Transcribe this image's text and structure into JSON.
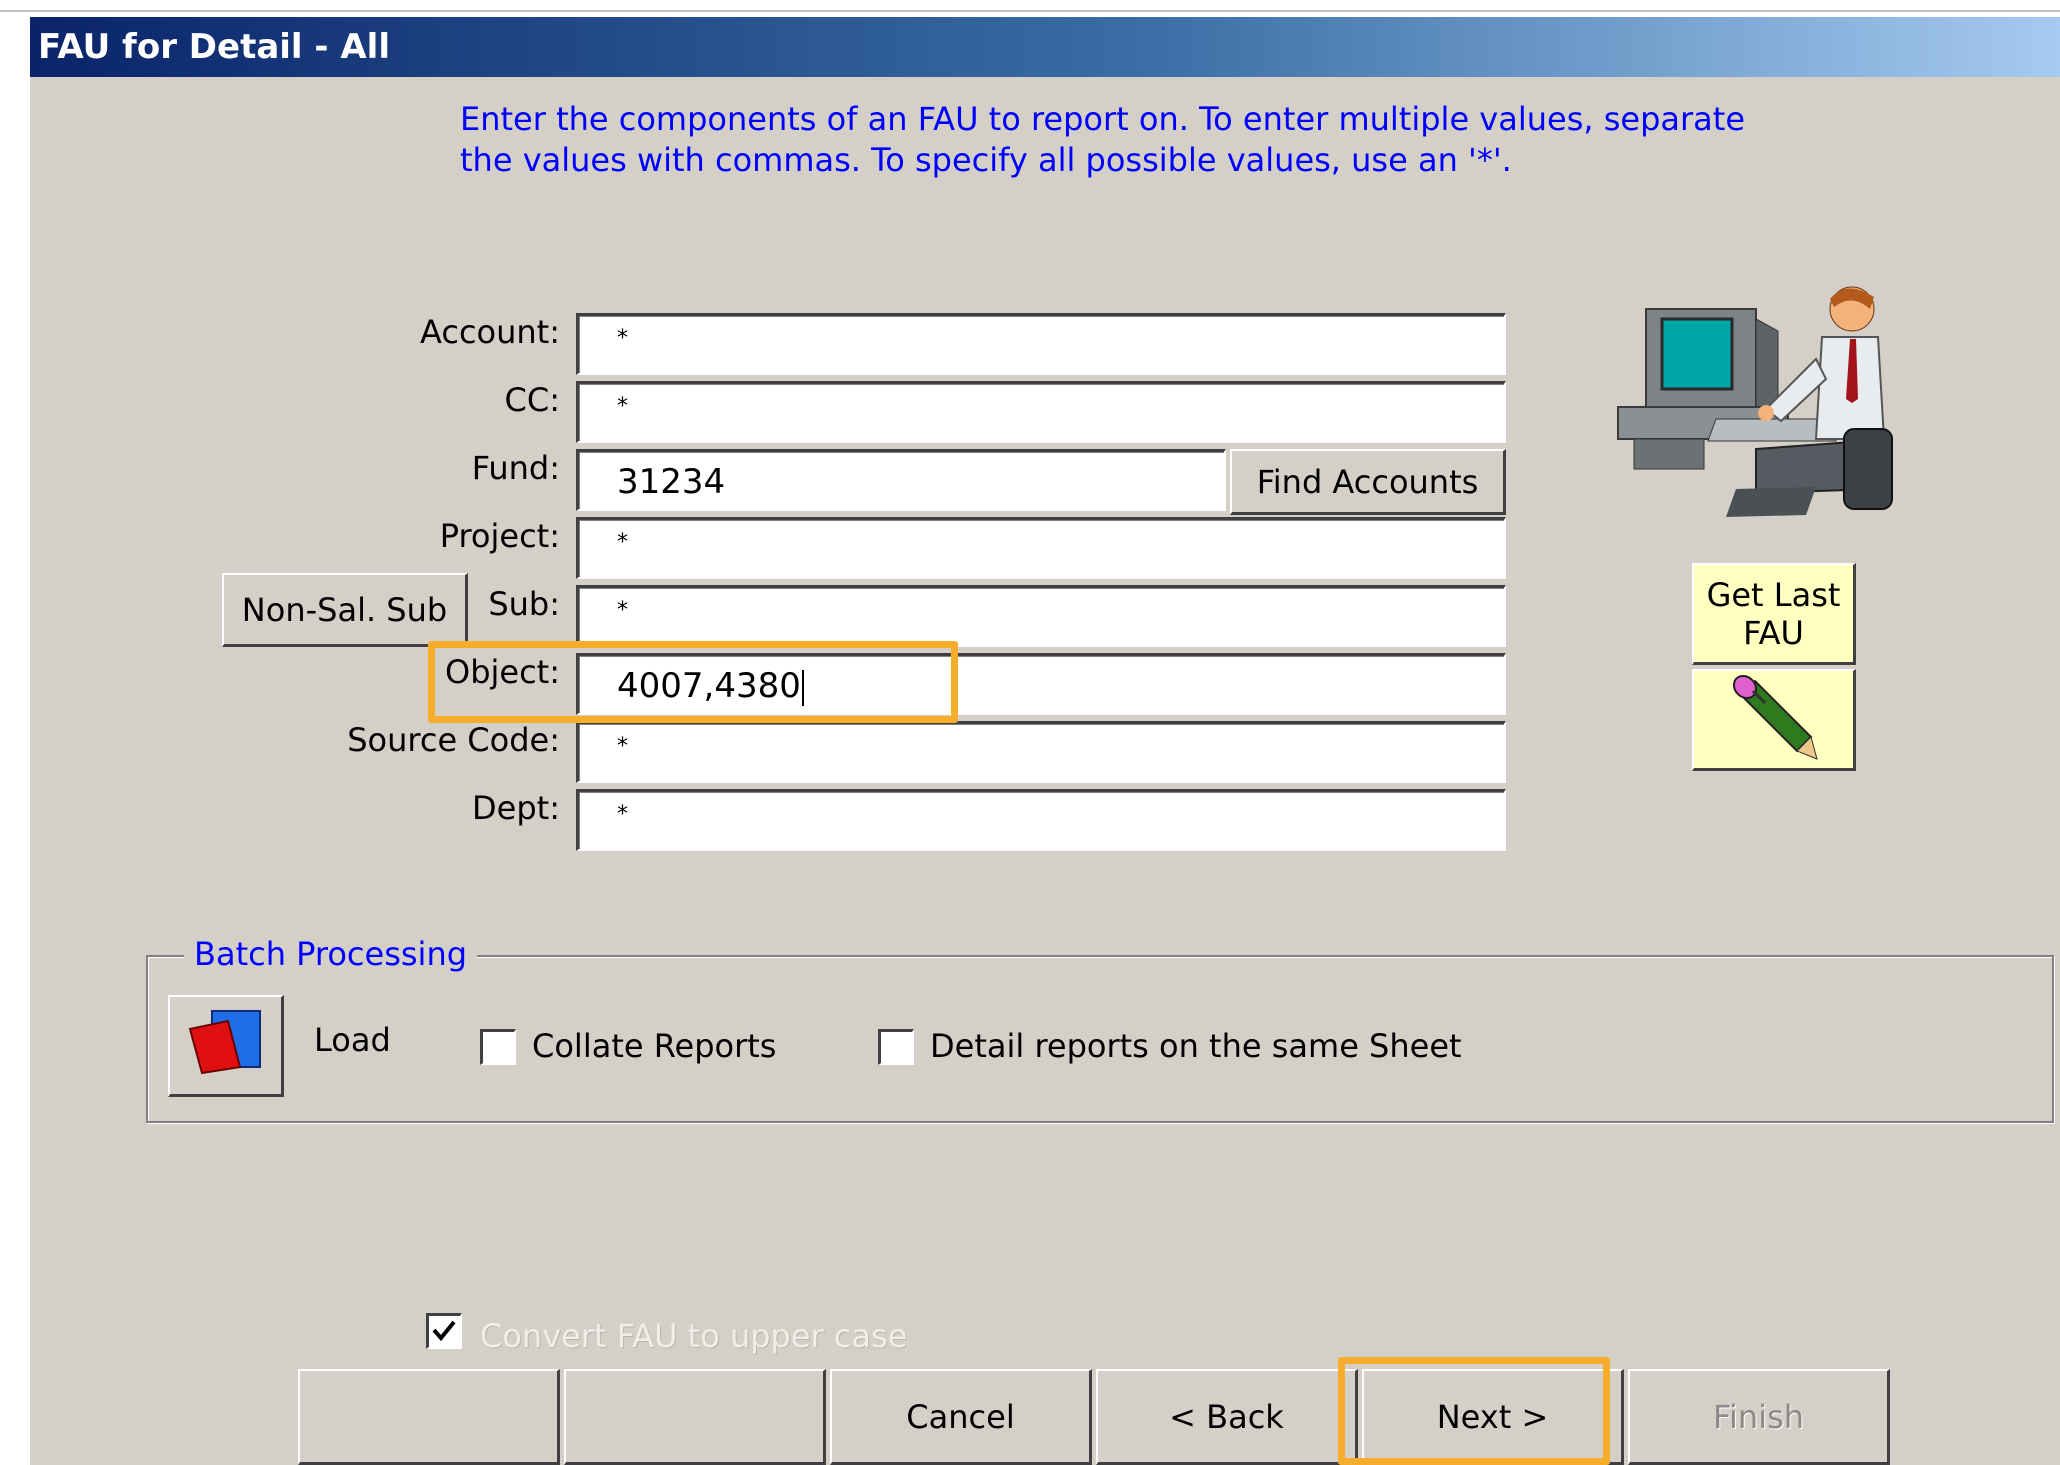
{
  "window": {
    "title": "FAU for Detail - All"
  },
  "instructions": {
    "line1": "Enter the components of an FAU to report on.  To enter multiple values, separate",
    "line2": "the values with commas.  To specify all possible values, use an '*'."
  },
  "fields": {
    "account": {
      "label": "Account:",
      "value": "*"
    },
    "cc": {
      "label": "CC:",
      "value": "*"
    },
    "fund": {
      "label": "Fund:",
      "value": "31234"
    },
    "project": {
      "label": "Project:",
      "value": "*"
    },
    "sub": {
      "label": "Sub:",
      "value": "*"
    },
    "object": {
      "label": "Object:",
      "value": "4007,4380"
    },
    "source_code": {
      "label": "Source Code:",
      "value": "*"
    },
    "dept": {
      "label": "Dept:",
      "value": "*"
    }
  },
  "buttons": {
    "find_accounts": "Find Accounts",
    "non_sal_sub": "Non-Sal. Sub",
    "get_last_fau_line1": "Get Last",
    "get_last_fau_line2": "FAU"
  },
  "batch": {
    "label": "Batch Processing",
    "load_label": "Load",
    "collate_label": "Collate Reports",
    "collate_checked": false,
    "same_sheet_label": "Detail reports on the same Sheet",
    "same_sheet_checked": false
  },
  "convert_upper": {
    "label": "Convert FAU  to upper case",
    "checked": true
  },
  "nav": {
    "blank1": "",
    "blank2": "",
    "cancel": "Cancel",
    "back": "<  Back",
    "next": "Next  >",
    "finish": "Finish"
  },
  "colors": {
    "title_start": "#0a246a",
    "title_end": "#a6caf0",
    "highlight": "#f6ad2c",
    "instruction_text": "#0000ff",
    "face": "#d4d0c8"
  },
  "icons": {
    "illustration": "person-at-computer-icon",
    "pencil": "pencil-icon",
    "folder": "open-folder-icon"
  }
}
